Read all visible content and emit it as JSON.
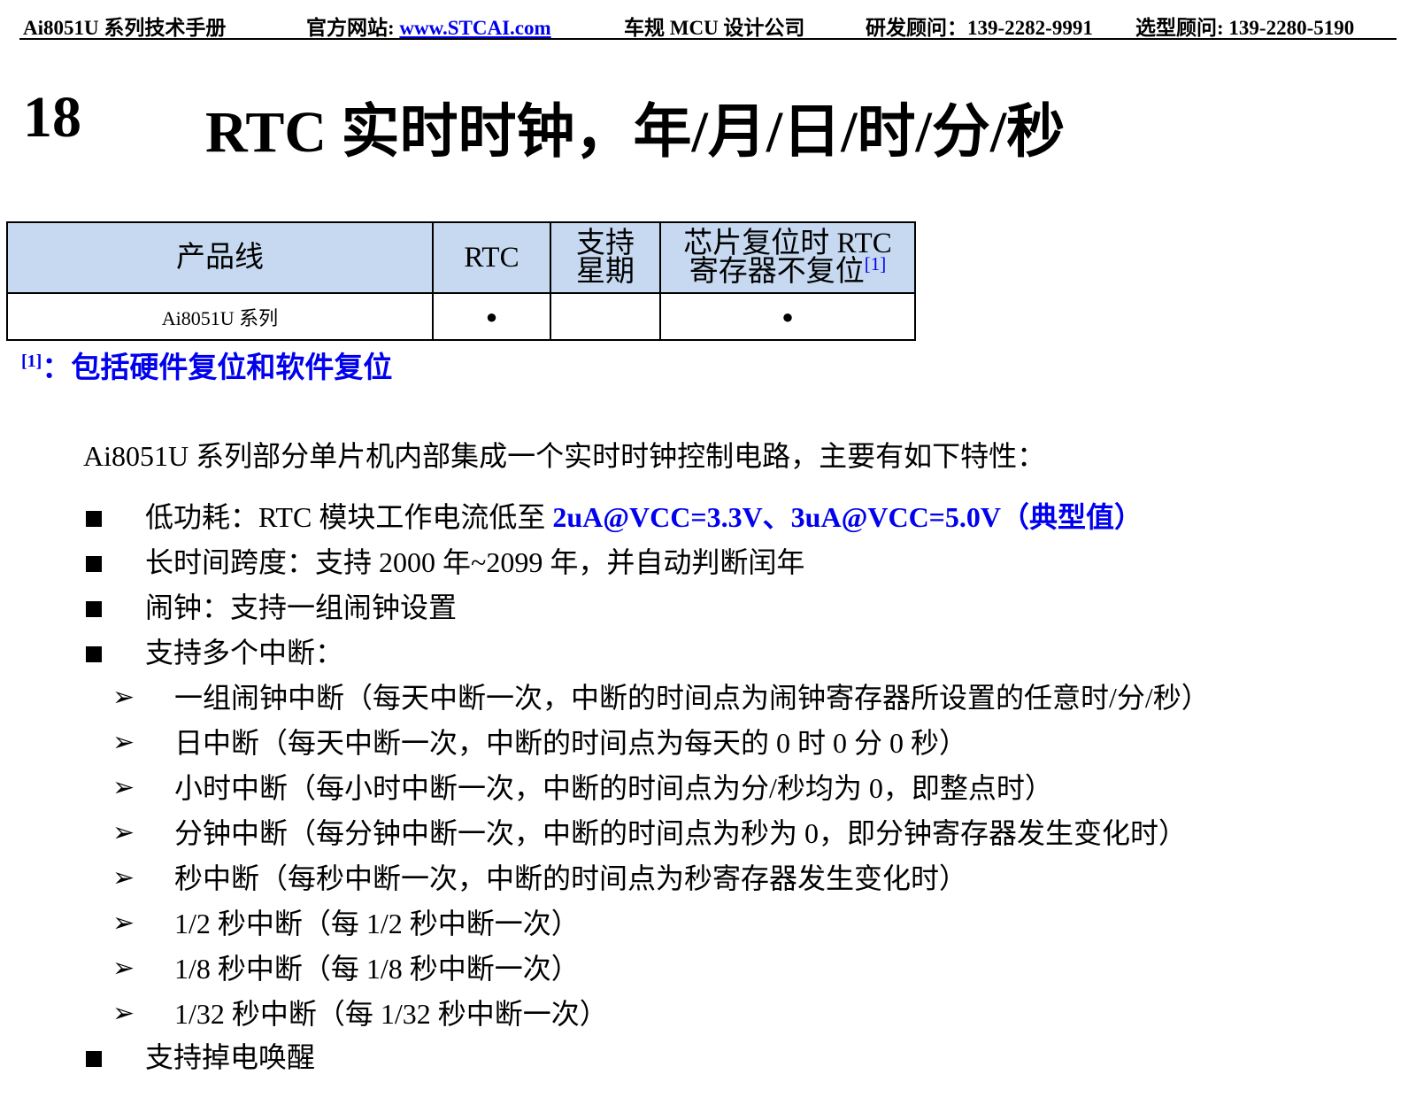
{
  "header": {
    "manual": "Ai8051U 系列技术手册",
    "site_label": "官方网站: ",
    "site_url": "www.STCAI.com",
    "company": "车规 MCU 设计公司",
    "rd_contact": "研发顾问：139-2282-9991",
    "sel_contact": "选型顾问: 139-2280-5190"
  },
  "chapter": {
    "number": "18",
    "title": "RTC 实时时钟，年/月/日/时/分/秒"
  },
  "table": {
    "headers": {
      "product_line": "产品线",
      "rtc": "RTC",
      "weekday_line1": "支持",
      "weekday_line2": "星期",
      "noreset_line1": "芯片复位时 RTC",
      "noreset_line2": "寄存器不复位",
      "noreset_note": "[1]"
    },
    "rows": [
      {
        "product": "Ai8051U 系列",
        "rtc": "●",
        "weekday": "",
        "noreset": "●"
      }
    ]
  },
  "footnote": {
    "mark": "[1]",
    "text": "：包括硬件复位和软件复位"
  },
  "intro": "Ai8051U 系列部分单片机内部集成一个实时时钟控制电路，主要有如下特性：",
  "features": {
    "power_prefix": "低功耗：RTC 模块工作电流低至 ",
    "power_value": "2uA@VCC=3.3V、3uA@VCC=5.0V（典型值）",
    "span": "长时间跨度：支持 2000 年~2099 年，并自动判断闰年",
    "alarm": "闹钟：支持一组闹钟设置",
    "interrupts": "支持多个中断：",
    "interrupt_items": [
      "一组闹钟中断（每天中断一次，中断的时间点为闹钟寄存器所设置的任意时/分/秒）",
      "日中断（每天中断一次，中断的时间点为每天的 0 时 0 分 0 秒）",
      "小时中断（每小时中断一次，中断的时间点为分/秒均为 0，即整点时）",
      "分钟中断（每分钟中断一次，中断的时间点为秒为 0，即分钟寄存器发生变化时）",
      "秒中断（每秒中断一次，中断的时间点为秒寄存器发生变化时）",
      "1/2 秒中断（每 1/2 秒中断一次）",
      "1/8 秒中断（每 1/8 秒中断一次）",
      "1/32 秒中断（每 1/32 秒中断一次）"
    ],
    "wakeup": "支持掉电唤醒"
  },
  "glyphs": {
    "arrow": "➢"
  },
  "colors": {
    "header_fill": "#c6d9f1",
    "highlight": "#0000ee"
  }
}
